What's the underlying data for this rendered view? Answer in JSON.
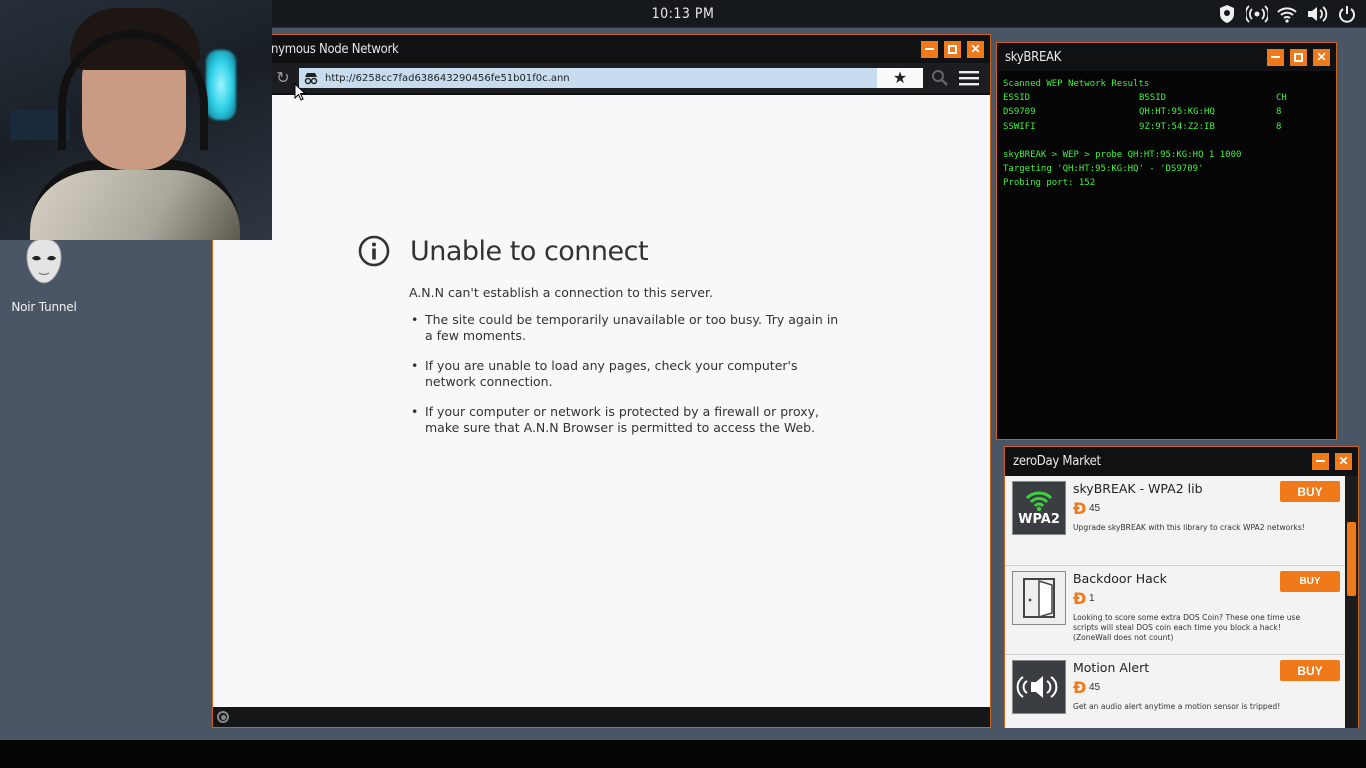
{
  "topbar": {
    "clock": "10:13 PM"
  },
  "desktop": {
    "icon_label": "Noir Tunnel"
  },
  "browser": {
    "title": "nymous Node Network",
    "url": "http://6258cc7fad638643290456fe51b01f0c.ann",
    "error": {
      "title": "Unable to connect",
      "lead": "A.N.N can't establish a connection to this server.",
      "bullets": [
        "The site could be temporarily unavailable or too busy. Try again in a few moments.",
        "If you are unable to load any pages, check your computer's network connection.",
        "If your computer or network is protected by a firewall or proxy, make sure that A.N.N Browser is permitted to access the Web."
      ]
    }
  },
  "terminal": {
    "title": "skyBREAK",
    "heading": "Scanned WEP Network Results",
    "columns": [
      "ESSID",
      "BSSID",
      "CH"
    ],
    "rows": [
      [
        "DS9709",
        "QH:HT:95:KG:HQ",
        "8"
      ],
      [
        "SSWIFI",
        "9Z:9T:54:Z2:IB",
        "8"
      ]
    ],
    "lines": [
      "skyBREAK > WEP > probe QH:HT:95:KG:HQ 1 1000",
      "Targeting 'QH:HT:95:KG:HQ' - 'DS9709'",
      "Probing port: 152"
    ]
  },
  "market": {
    "title": "zeroDay Market",
    "buy_label": "BUY",
    "items": [
      {
        "name": "skyBREAK - WPA2 lib",
        "price": "45",
        "icon_text": "WPA2",
        "desc": "Upgrade skyBREAK with this library to crack WPA2 networks!"
      },
      {
        "name": "Backdoor Hack",
        "price": "1",
        "icon_text": "",
        "desc": "Looking to score some extra DOS Coin? These one time use scripts will steal DOS coin each time you block a hack! (ZoneWall does not count)"
      },
      {
        "name": "Motion Alert",
        "price": "45",
        "icon_text": "",
        "desc": "Get an audio alert anytime a motion sensor is tripped!"
      }
    ]
  },
  "colors": {
    "accent": "#f07a1a",
    "terminal_text": "#3ef03e",
    "desktop": "#4a5666"
  }
}
